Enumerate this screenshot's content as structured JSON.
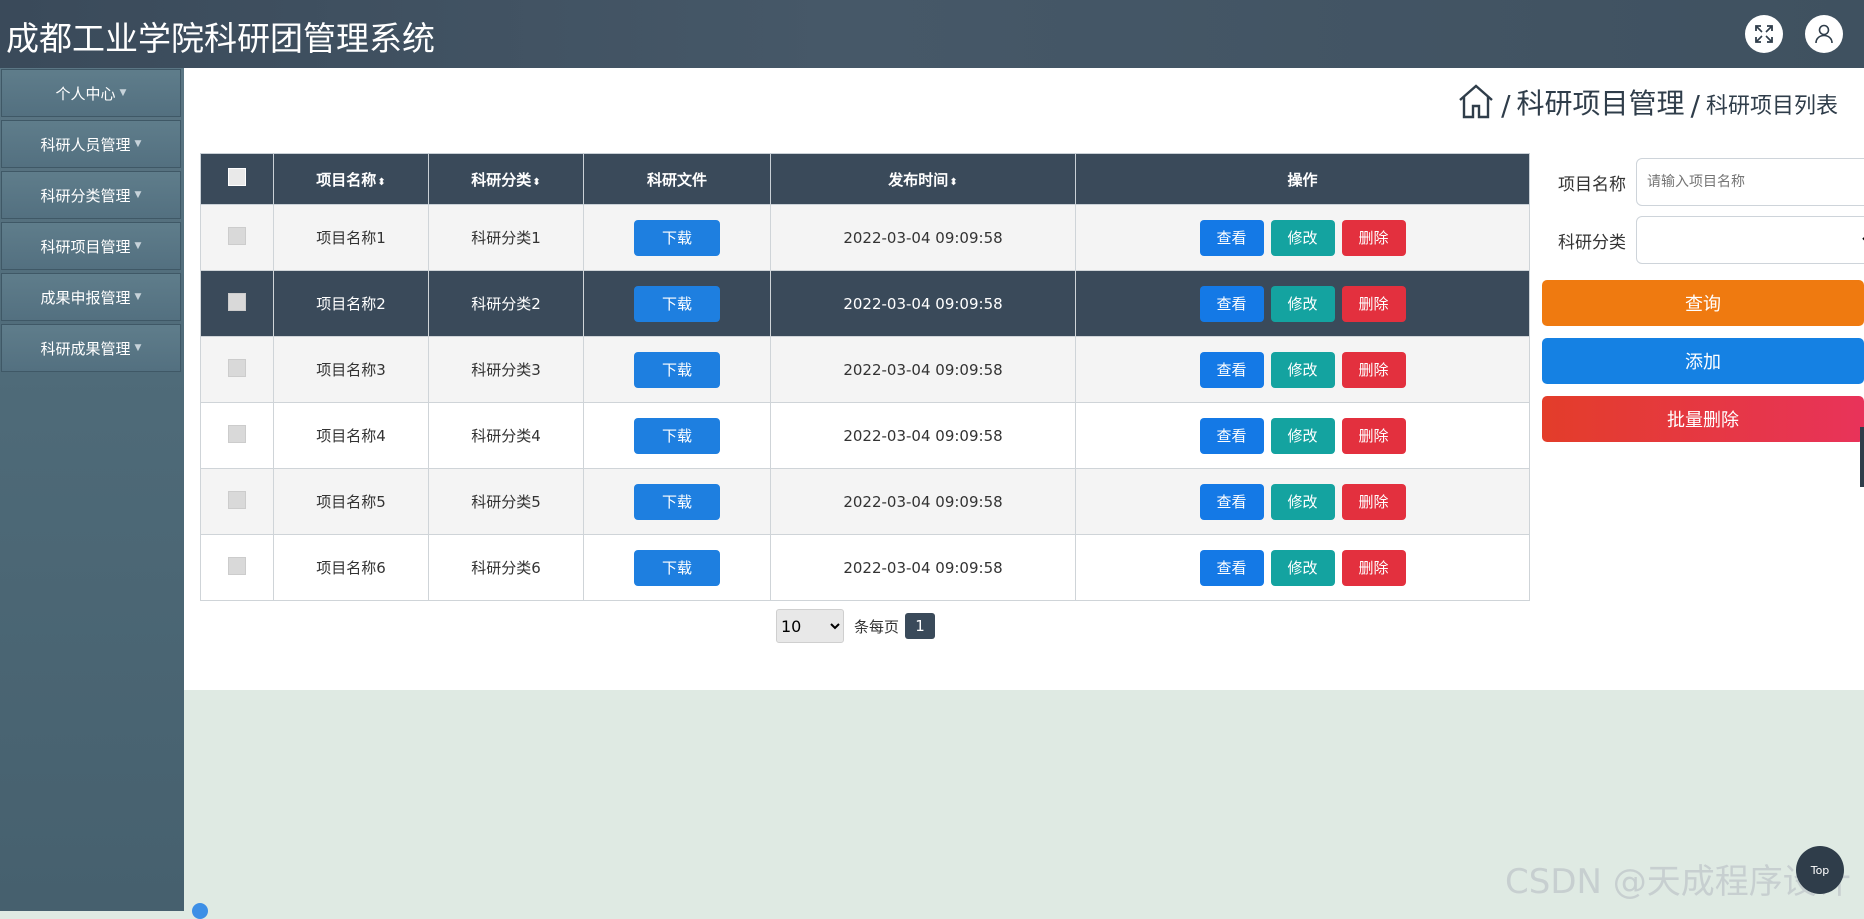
{
  "header": {
    "title": "成都工业学院科研团管理系统",
    "fullscreen_icon": "expand-icon",
    "user_icon": "user-icon"
  },
  "sidebar": {
    "items": [
      {
        "label": "个人中心"
      },
      {
        "label": "科研人员管理"
      },
      {
        "label": "科研分类管理"
      },
      {
        "label": "科研项目管理"
      },
      {
        "label": "成果申报管理"
      },
      {
        "label": "科研成果管理"
      }
    ]
  },
  "breadcrumb": {
    "home_icon": "home-icon",
    "sep": "/",
    "level1": "科研项目管理",
    "level2": "科研项目列表"
  },
  "table": {
    "headers": [
      "项目名称",
      "科研分类",
      "科研文件",
      "发布时间",
      "操作"
    ],
    "sort_icon": "⬍",
    "rows": [
      {
        "name": "项目名称1",
        "category": "科研分类1",
        "file": "下载",
        "time": "2022-03-04 09:09:58"
      },
      {
        "name": "项目名称2",
        "category": "科研分类2",
        "file": "下载",
        "time": "2022-03-04 09:09:58"
      },
      {
        "name": "项目名称3",
        "category": "科研分类3",
        "file": "下载",
        "time": "2022-03-04 09:09:58"
      },
      {
        "name": "项目名称4",
        "category": "科研分类4",
        "file": "下载",
        "time": "2022-03-04 09:09:58"
      },
      {
        "name": "项目名称5",
        "category": "科研分类5",
        "file": "下载",
        "time": "2022-03-04 09:09:58"
      },
      {
        "name": "项目名称6",
        "category": "科研分类6",
        "file": "下载",
        "time": "2022-03-04 09:09:58"
      }
    ],
    "actions": {
      "view": "查看",
      "edit": "修改",
      "delete": "删除"
    }
  },
  "pagination": {
    "page_size": "10",
    "per_page_label": "条每页",
    "current_page": "1"
  },
  "search": {
    "name_label": "项目名称",
    "name_placeholder": "请输入项目名称",
    "category_label": "科研分类",
    "category_value": "",
    "query_button": "查询",
    "add_button": "添加",
    "batch_delete_button": "批量删除"
  },
  "colors": {
    "header_bg": "#3a4a5a",
    "primary": "#1e7fe0",
    "teal": "#14a3a0",
    "danger": "#e3303e",
    "query": "#ef7a10"
  },
  "watermark": "CSDN @天成程序设计",
  "scroll_top_label": "Top"
}
